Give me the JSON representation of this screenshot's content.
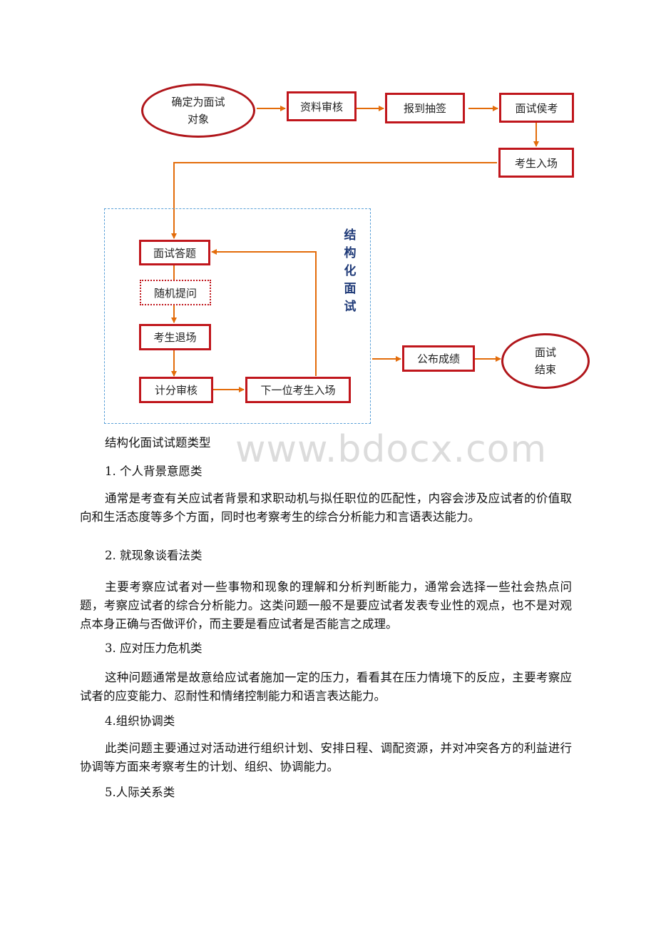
{
  "flowchart": {
    "start": {
      "line1": "确定为面试",
      "line2": "对象"
    },
    "step_review": "资料审核",
    "step_checkin": "报到抽签",
    "step_wait": "面试侯考",
    "step_enter": "考生入场",
    "group_label": [
      "结",
      "构",
      "化",
      "面",
      "试"
    ],
    "step_answer": "面试答题",
    "step_random_question": "随机提问",
    "step_exit": "考生退场",
    "step_score": "计分审核",
    "step_next": "下一位考生入场",
    "step_publish": "公布成绩",
    "end": {
      "line1": "面试",
      "line2": "结束"
    }
  },
  "watermark": "www.bdocx.com",
  "document": {
    "title": "结构化面试试题类型",
    "sections": [
      {
        "heading": "1. 个人背景意愿类",
        "body": "通常是考查有关应试者背景和求职动机与拟任职位的匹配性，内容会涉及应试者的价值取向和生活态度等多个方面，同时也考察考生的综合分析能力和言语表达能力。"
      },
      {
        "heading": "2. 就现象谈看法类",
        "body": "主要考察应试者对一些事物和现象的理解和分析判断能力，通常会选择一些社会热点问题，考察应试者的综合分析能力。这类问题一般不是要应试者发表专业性的观点，也不是对观点本身正确与否做评价，而主要是看应试者是否能言之成理。"
      },
      {
        "heading": "3. 应对压力危机类",
        "body": "这种问题通常是故意给应试者施加一定的压力，看看其在压力情境下的反应，主要考察应试者的应变能力、忍耐性和情绪控制能力和语言表达能力。"
      },
      {
        "heading": "4.组织协调类",
        "body": "此类问题主要通过对活动进行组织计划、安排日程、调配资源，并对冲突各方的利益进行协调等方面来考察考生的计划、组织、协调能力。"
      },
      {
        "heading": "5.人际关系类"
      }
    ]
  }
}
